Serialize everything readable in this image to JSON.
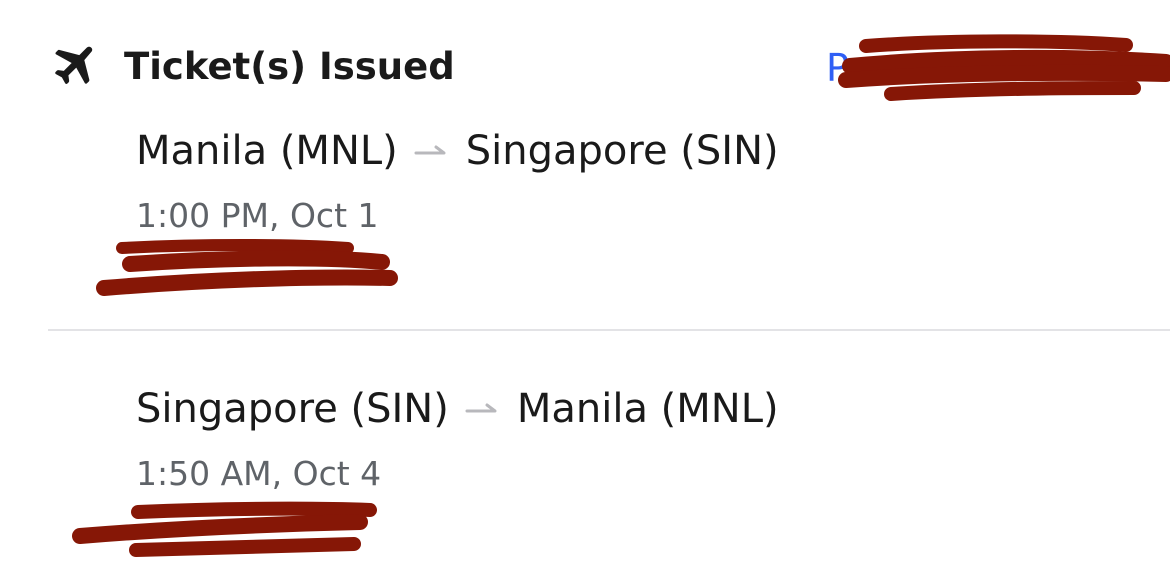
{
  "header": {
    "title": "Ticket(s) Issued",
    "icon": "airplane-icon",
    "link_visible": "P"
  },
  "flights": [
    {
      "origin": "Manila (MNL)",
      "destination": "Singapore (SIN)",
      "time": "1:00 PM, Oct 1"
    },
    {
      "origin": "Singapore (SIN)",
      "destination": "Manila (MNL)",
      "time": "1:50 AM, Oct 4"
    }
  ],
  "colors": {
    "link": "#2f5ff5",
    "redaction": "#861706",
    "secondary_text": "#5f6368",
    "divider": "#e3e3e6"
  }
}
